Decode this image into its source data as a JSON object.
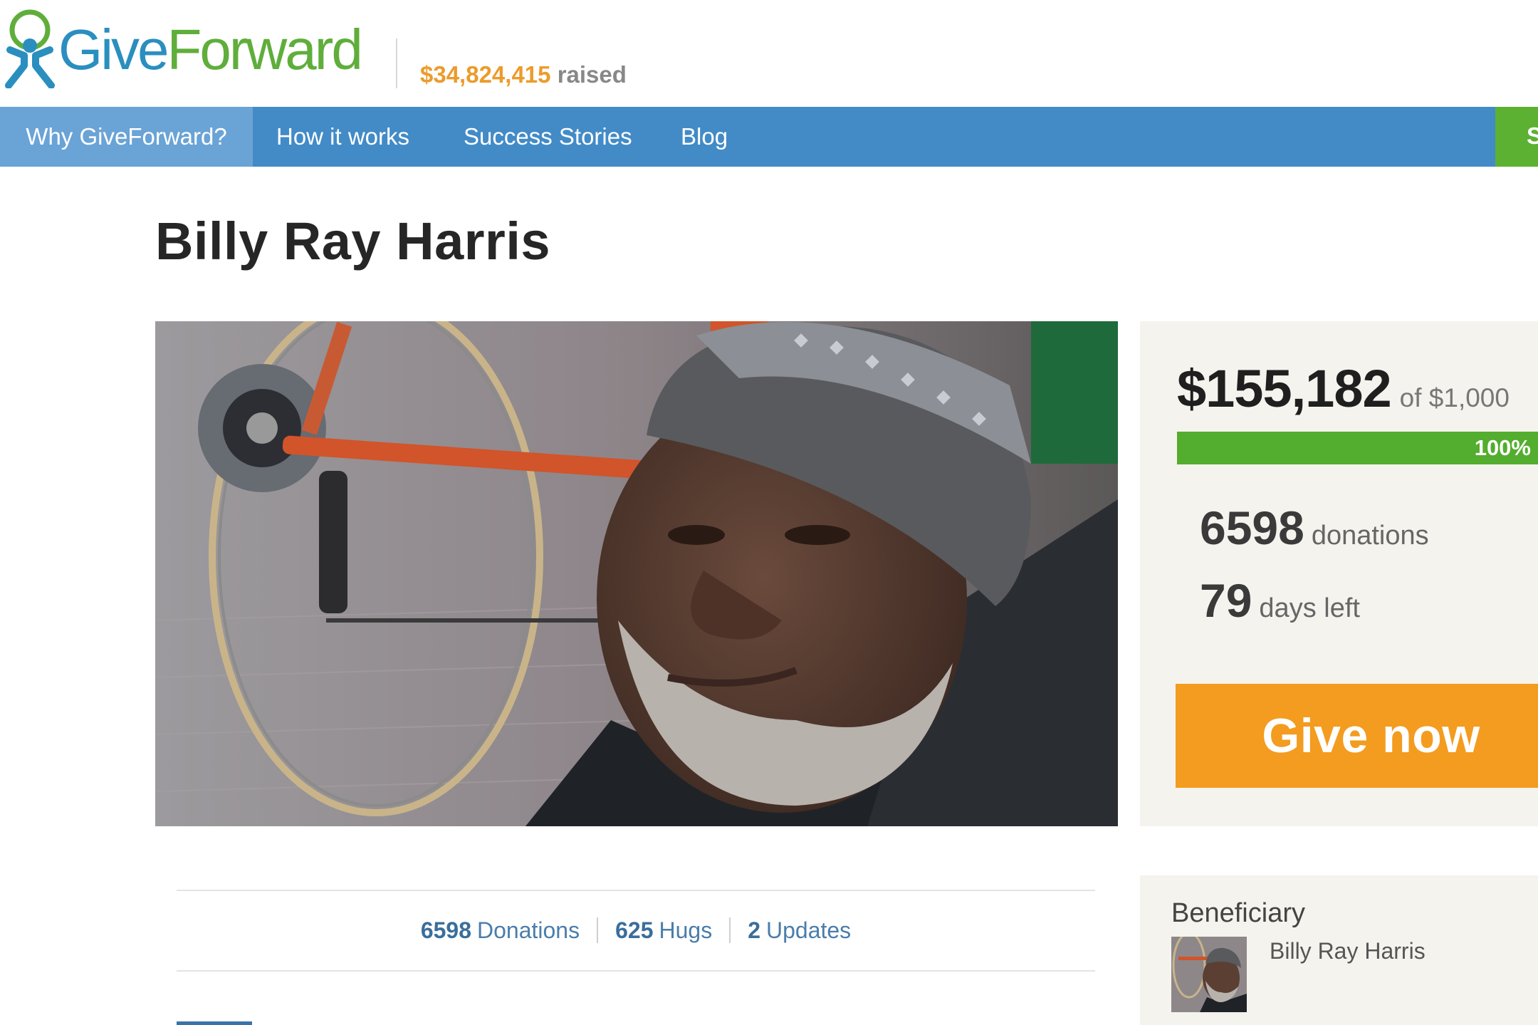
{
  "header": {
    "logo_give": "Give",
    "logo_forward": "Forward",
    "raised_amount": "$34,824,415",
    "raised_label": "raised",
    "colors": {
      "give": "#2a8fbf",
      "forward": "#5fae3b",
      "raised": "#ec9b2b"
    }
  },
  "nav": {
    "items": [
      {
        "label": "Why GiveForward?",
        "active": true
      },
      {
        "label": "How it works",
        "active": false
      },
      {
        "label": "Success Stories",
        "active": false
      },
      {
        "label": "Blog",
        "active": false
      }
    ],
    "cta_partial": "S",
    "colors": {
      "bar": "#428bc7",
      "active": "#6aa3d6",
      "cta": "#5cb133"
    }
  },
  "page": {
    "title": "Billy Ray Harris"
  },
  "campaign": {
    "raised": "$155,182",
    "goal": "of $1,000",
    "progress_label": "100%",
    "progress_fraction": 1.0,
    "donations_count": "6598",
    "donations_label": "donations",
    "days_left_count": "79",
    "days_left_label": "days left",
    "give_button": "Give now",
    "colors": {
      "progress": "#53ad2e",
      "give_button": "#f39c1f"
    }
  },
  "stats_bar": {
    "donations_num": "6598",
    "donations_label": "Donations",
    "hugs_num": "625",
    "hugs_label": "Hugs",
    "updates_num": "2",
    "updates_label": "Updates"
  },
  "beneficiary": {
    "title": "Beneficiary",
    "name": "Billy Ray Harris"
  }
}
